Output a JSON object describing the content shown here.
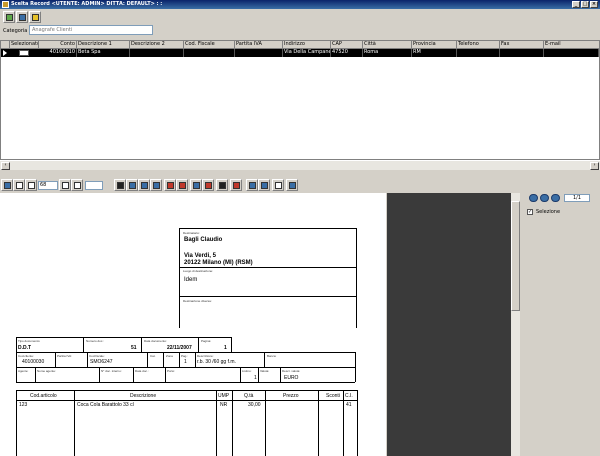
{
  "window": {
    "title": "Scelta Record    <UTENTE: ADMIN>    DITTA: DEFAULT> :  :"
  },
  "filter": {
    "category_label": "Categoria",
    "category_value": "Anagrafe Clienti"
  },
  "grid": {
    "columns": [
      "Selezionato",
      "Conto",
      "Descrizione 1",
      "Descrizione 2",
      "Cod. Fiscale",
      "Partita IVA",
      "Indirizzo",
      "CAP",
      "Città",
      "Provincia",
      "Telefono",
      "Fax",
      "E-mail"
    ],
    "rows": [
      {
        "selezionato": "",
        "conto": "40100010",
        "descrizione1": "Beta Spa",
        "descrizione2": "",
        "cod_fiscale": "",
        "partita_iva": "",
        "indirizzo": "Via Della Campanella",
        "cap": "47520",
        "citta": "Roma",
        "provincia": "RM",
        "telefono": "",
        "fax": "",
        "email": ""
      }
    ]
  },
  "preview": {
    "zoom": "68"
  },
  "side": {
    "page_indicator": "1/1",
    "selection_label": "Selezione",
    "selection_checked": true
  },
  "document": {
    "destinatario_label": "Destinatario:",
    "dest_name": "Bagli Claudio",
    "dest_street": "Via Verdi, 5",
    "dest_city": "20122 Milano (MI) (RSM)",
    "luogo_label": "Luogo di destinazione:",
    "luogo_value": "Idem",
    "dest_diversa_label": "Destinazione diversa:",
    "tipo_doc_label": "Tipo documento:",
    "tipo_doc": "D.D.T",
    "numero_doc_label": "Numero doc.:",
    "numero_doc": "51",
    "data_doc_label": "Data documento:",
    "data_doc": "22/11/2007",
    "pagina_label": "Pagina:",
    "pagina": "1",
    "cod_cliente_label": "Cod.cliente:",
    "cod_cliente": "40100030",
    "partita_iva_label": "Partita IVA:",
    "cod_fiscale_label": "Cod.fiscale:",
    "cod_fiscale": "SMO6247",
    "cat_label": "Cat.",
    "zona_label": "Zona",
    "pag_label": "Pag.:",
    "pag_code": "1",
    "descrizione_label": "Descrizione:",
    "pag_desc": "r.b. 30 /60 gg f.m.",
    "banca_label": "Banca:",
    "agente_label": "Agente:",
    "nome_agente_label": "Nome agente:",
    "num_rif_label": "N° doc. interno:",
    "data_rif_label": "Data doc.:",
    "porto_label": "Porto:",
    "listino_label": "Listino:",
    "listino": "1",
    "valuta_label": "Valuta:",
    "descr_valuta_label": "Descr. valuta:",
    "valuta": "EURO",
    "table_headers": [
      "Cod.articolo",
      "Descrizione",
      "UMP",
      "Q.tà",
      "Prezzo",
      "Sconti",
      "C.I."
    ],
    "items": [
      {
        "codice": "123",
        "descrizione": "Coca Cola Barattolo 33 cl",
        "ump": "NR",
        "qta": "30,00",
        "prezzo": "",
        "sconti": "",
        "ci": "41"
      }
    ]
  }
}
